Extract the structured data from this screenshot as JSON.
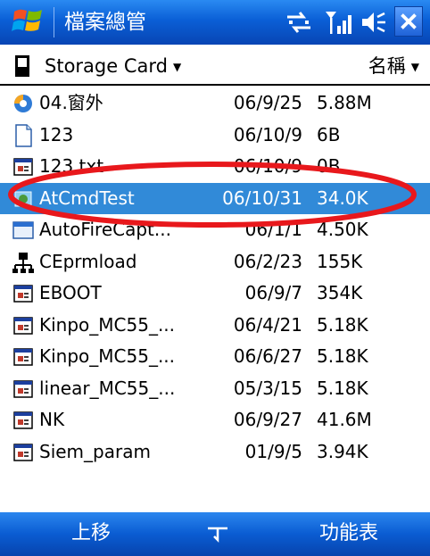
{
  "titlebar": {
    "title": "檔案總管",
    "start_icon": "windows-flag-icon",
    "status_icons": [
      "connectivity-icon",
      "signal-strength-icon",
      "volume-icon"
    ],
    "close_icon": "close-icon"
  },
  "pathbar": {
    "folder": "Storage Card",
    "sort": "名稱"
  },
  "files": [
    {
      "name": "04.窗外",
      "date": "06/9/25",
      "size": "5.88M",
      "icon": "audio-file-icon"
    },
    {
      "name": "123",
      "date": "06/10/9",
      "size": "6B",
      "icon": "document-icon"
    },
    {
      "name": "123.txt",
      "date": "06/10/9",
      "size": "0B",
      "icon": "program-icon"
    },
    {
      "name": "AtCmdTest",
      "date": "06/10/31",
      "size": "34.0K",
      "icon": "app-icon",
      "selected": true
    },
    {
      "name": "AutoFireCapt...",
      "date": "06/1/1",
      "size": "4.50K",
      "icon": "window-app-icon"
    },
    {
      "name": "CEprmload",
      "date": "06/2/23",
      "size": "155K",
      "icon": "network-icon"
    },
    {
      "name": "EBOOT",
      "date": "06/9/7",
      "size": "354K",
      "icon": "program-icon"
    },
    {
      "name": "Kinpo_MC55_...",
      "date": "06/4/21",
      "size": "5.18K",
      "icon": "program-icon"
    },
    {
      "name": "Kinpo_MC55_...",
      "date": "06/6/27",
      "size": "5.18K",
      "icon": "program-icon"
    },
    {
      "name": "linear_MC55_...",
      "date": "05/3/15",
      "size": "5.18K",
      "icon": "program-icon"
    },
    {
      "name": "NK",
      "date": "06/9/27",
      "size": "41.6M",
      "icon": "program-icon"
    },
    {
      "name": "Siem_param",
      "date": "01/9/5",
      "size": "3.94K",
      "icon": "program-icon"
    }
  ],
  "menubar": {
    "left": "上移",
    "right": "功能表",
    "center_icon": "keyboard-sip-icon"
  },
  "colors": {
    "titlebar": "#0a5fd6",
    "selection": "#318ad8",
    "annotation": "#e8181c"
  }
}
